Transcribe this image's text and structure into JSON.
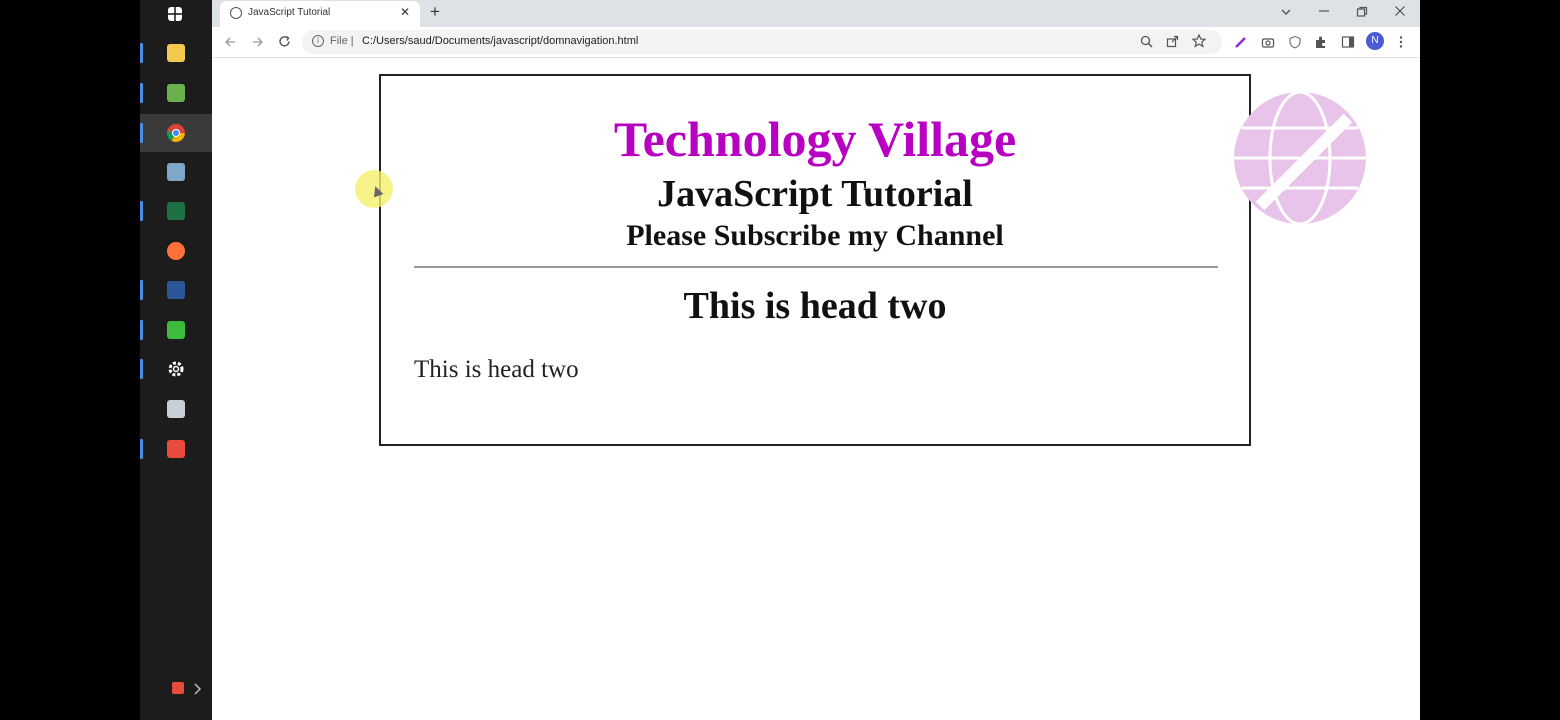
{
  "browser": {
    "tab_title": "JavaScript Tutorial",
    "tab_close": "✕",
    "new_tab": "+",
    "omnibox_scheme": "File |",
    "omnibox_url": "C:/Users/saud/Documents/javascript/domnavigation.html",
    "profile_initial": "N"
  },
  "page": {
    "title": "Technology Village",
    "subtitle": "JavaScript Tutorial",
    "tagline": "Please Subscribe my Channel",
    "heading": "This is head two",
    "paragraph": "This is head two"
  },
  "colors": {
    "title": "#b800c2",
    "taskbar": "#1c1c1c",
    "tabstrip": "#dee1e6"
  },
  "icons": {
    "taskbar": [
      "windows-start-icon",
      "file-explorer-icon",
      "notepad-icon",
      "chrome-icon",
      "app-icon",
      "excel-icon",
      "firefox-icon",
      "word-icon",
      "camtasia-icon",
      "settings-icon",
      "app-icon-2",
      "recorder-icon"
    ]
  }
}
